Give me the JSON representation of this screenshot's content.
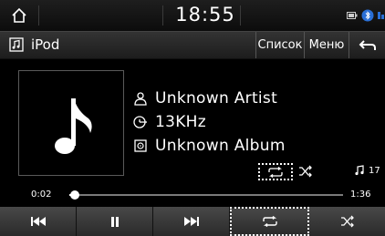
{
  "statusbar": {
    "time": "18:55",
    "icons": [
      "home-icon",
      "battery-icon",
      "bluetooth-icon",
      "signal-icon"
    ]
  },
  "titlebar": {
    "source_label": "iPod",
    "list_label": "Список",
    "menu_label": "Меню",
    "back_icon": "back-arrow-icon"
  },
  "track": {
    "artist": "Unknown Artist",
    "quality": "13KHz",
    "album": "Unknown Album",
    "track_number": "17"
  },
  "progress": {
    "elapsed": "0:02",
    "duration": "1:36",
    "fraction": 0.021
  },
  "controls": [
    "previous-icon",
    "pause-icon",
    "next-icon",
    "repeat-icon",
    "shuffle-icon"
  ],
  "colors": {
    "background": "#000000",
    "text": "#ffffff",
    "button": "#3a3a3a",
    "progress_track": "#7a7a7a"
  }
}
